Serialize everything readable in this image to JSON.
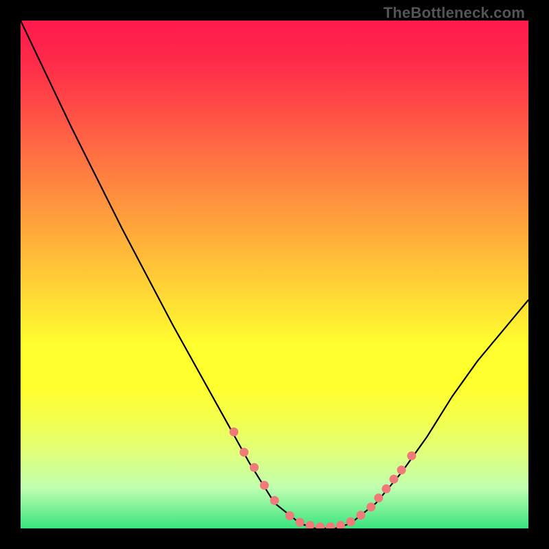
{
  "watermark": "TheBottleneck.com",
  "chart_data": {
    "type": "line",
    "title": "",
    "xlabel": "",
    "ylabel": "",
    "xlim": [
      0,
      100
    ],
    "ylim": [
      0,
      100
    ],
    "background": "heatmap-gradient",
    "curve": [
      {
        "x": 0,
        "y": 100
      },
      {
        "x": 10,
        "y": 79
      },
      {
        "x": 20,
        "y": 59
      },
      {
        "x": 30,
        "y": 40
      },
      {
        "x": 40,
        "y": 22
      },
      {
        "x": 45,
        "y": 13
      },
      {
        "x": 50,
        "y": 5
      },
      {
        "x": 55,
        "y": 1
      },
      {
        "x": 58,
        "y": 0
      },
      {
        "x": 62,
        "y": 0
      },
      {
        "x": 65,
        "y": 1
      },
      {
        "x": 70,
        "y": 5
      },
      {
        "x": 75,
        "y": 11
      },
      {
        "x": 80,
        "y": 18
      },
      {
        "x": 85,
        "y": 26
      },
      {
        "x": 90,
        "y": 33
      },
      {
        "x": 95,
        "y": 39
      },
      {
        "x": 100,
        "y": 45
      }
    ],
    "marker_points": [
      {
        "x": 42,
        "y": 19
      },
      {
        "x": 44,
        "y": 15
      },
      {
        "x": 46,
        "y": 12
      },
      {
        "x": 48,
        "y": 8.5
      },
      {
        "x": 50,
        "y": 5.5
      },
      {
        "x": 53,
        "y": 2.5
      },
      {
        "x": 55,
        "y": 1.2
      },
      {
        "x": 57,
        "y": 0.6
      },
      {
        "x": 59,
        "y": 0.3
      },
      {
        "x": 61,
        "y": 0.3
      },
      {
        "x": 63,
        "y": 0.6
      },
      {
        "x": 65,
        "y": 1.3
      },
      {
        "x": 67,
        "y": 2.6
      },
      {
        "x": 69,
        "y": 4.2
      },
      {
        "x": 70.5,
        "y": 6
      },
      {
        "x": 72,
        "y": 7.8
      },
      {
        "x": 73.5,
        "y": 9.7
      },
      {
        "x": 75,
        "y": 11.5
      },
      {
        "x": 77,
        "y": 14.3
      }
    ],
    "marker_color": "#f07a7a",
    "curve_color": "#000000",
    "gradient_stops": [
      {
        "pos": 0,
        "color": "#ff1a4d"
      },
      {
        "pos": 50,
        "color": "#ffd838"
      },
      {
        "pos": 75,
        "color": "#ffff2e"
      },
      {
        "pos": 100,
        "color": "#39e47e"
      }
    ]
  }
}
